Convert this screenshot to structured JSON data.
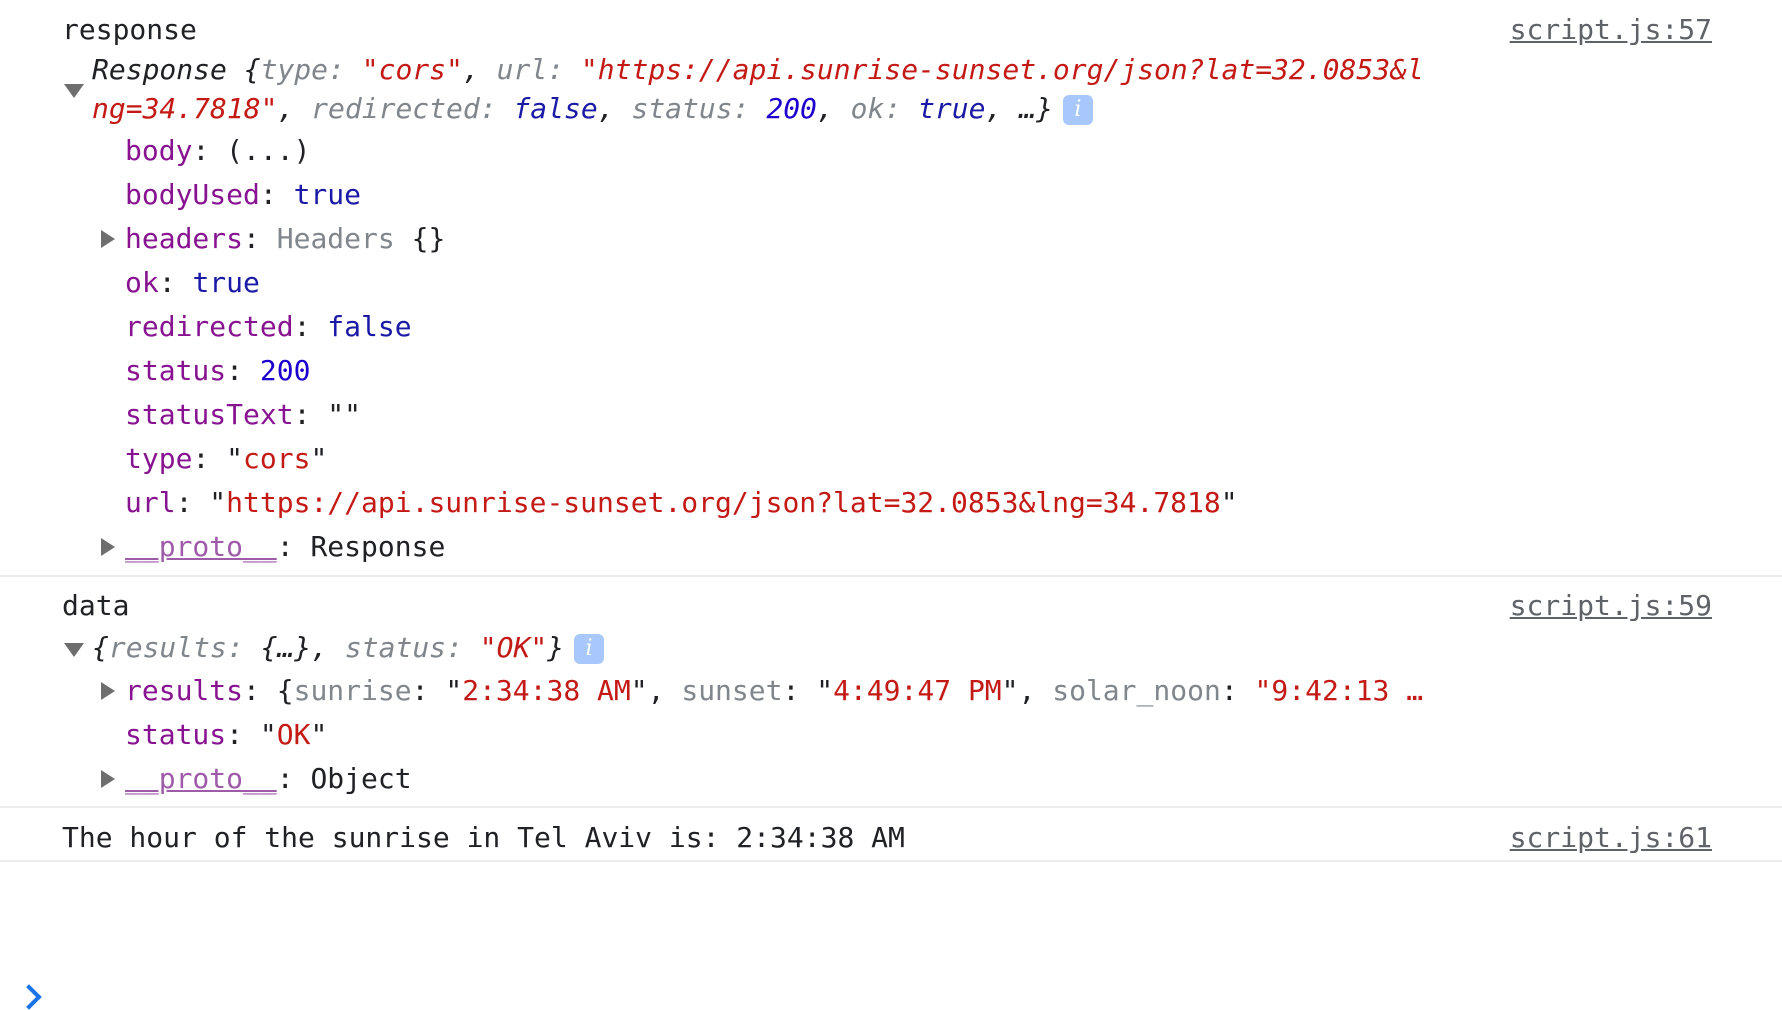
{
  "entries": [
    {
      "label": "response",
      "source": "script.js:57",
      "summary": {
        "prefix": "Response {",
        "type_key": "type",
        "type_val": "\"cors\"",
        "url_key": "url",
        "url_val_part1": "\"https://api.sunrise-sunset.org/json?lat=32.0853&l",
        "url_val_part2": "ng=34.7818\"",
        "redirected_key": "redirected",
        "redirected_val": "false",
        "status_key": "status",
        "status_val": "200",
        "ok_key": "ok",
        "ok_val": "true",
        "suffix": ", …}"
      },
      "props": {
        "body_key": "body",
        "body_val": "(...)",
        "bodyUsed_key": "bodyUsed",
        "bodyUsed_val": "true",
        "headers_key": "headers",
        "headers_type": "Headers",
        "headers_val": "{}",
        "ok_key": "ok",
        "ok_val": "true",
        "redirected_key": "redirected",
        "redirected_val": "false",
        "status_key": "status",
        "status_val": "200",
        "statusText_key": "statusText",
        "statusText_val": "\"\"",
        "type_key": "type",
        "type_val": "cors",
        "url_key": "url",
        "url_val": "https://api.sunrise-sunset.org/json?lat=32.0853&lng=34.7818",
        "proto_key": "__proto__",
        "proto_val": "Response"
      }
    },
    {
      "label": "data",
      "source": "script.js:59",
      "summary": {
        "prefix": "{",
        "results_key": "results",
        "results_val": "{…}",
        "status_key": "status",
        "status_val": "\"OK\"",
        "suffix": "}"
      },
      "props": {
        "results_key": "results",
        "sunrise_key": "sunrise",
        "sunrise_val": "2:34:38 AM",
        "sunset_key": "sunset",
        "sunset_val": "4:49:47 PM",
        "solar_noon_key": "solar_noon",
        "solar_noon_val": "\"9:42:13 …",
        "status_key": "status",
        "status_val": "OK",
        "proto_key": "__proto__",
        "proto_val": "Object"
      }
    },
    {
      "label": "The hour of the sunrise in Tel Aviv is: 2:34:38 AM",
      "source": "script.js:61"
    }
  ],
  "info_badge": "i"
}
